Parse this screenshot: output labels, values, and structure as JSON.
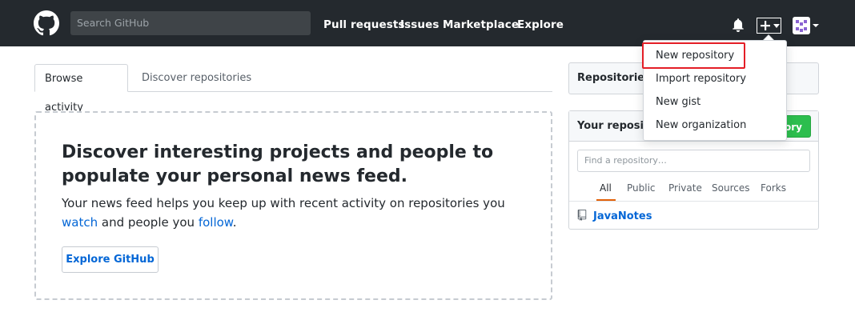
{
  "header": {
    "search_placeholder": "Search GitHub",
    "nav": [
      "Pull requests",
      "Issues",
      "Marketplace",
      "Explore"
    ]
  },
  "tabs": [
    "Browse activity",
    "Discover repositories"
  ],
  "discover": {
    "title": "Discover interesting projects and people to populate your personal news feed.",
    "text_part1": "Your news feed helps you keep up with recent activity on repositories you ",
    "link_watch": "watch",
    "text_part2": " and people you ",
    "link_follow": "follow",
    "text_part3": ".",
    "button": "Explore GitHub"
  },
  "sidebar": {
    "box1_title": "Repositories y",
    "box2_title": "Your reposito",
    "new_button": "tory",
    "find_placeholder": "Find a repository…",
    "filters": [
      "All",
      "Public",
      "Private",
      "Sources",
      "Forks"
    ],
    "repos": [
      "JavaNotes"
    ]
  },
  "dropdown": {
    "items": [
      "New repository",
      "Import repository",
      "New gist",
      "New organization"
    ],
    "highlighted_index": 0
  },
  "colors": {
    "header_bg": "#24292e",
    "link": "#0366d6",
    "highlight": "#e41e26",
    "green_button": "#2cbe4e"
  }
}
